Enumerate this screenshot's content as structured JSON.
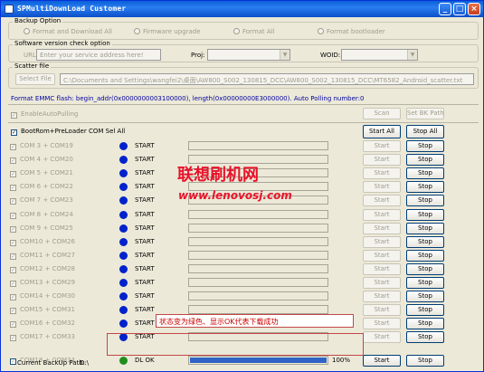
{
  "window": {
    "title": "SPMultiDownLoad Customer",
    "min": "_",
    "max": "□",
    "close": "×"
  },
  "backup_option": {
    "label": "Backup Option",
    "options": [
      "Format and Download All",
      "Firmware upgrade",
      "Format All",
      "Format bootloader"
    ]
  },
  "sw_check": {
    "label": "Software version check option",
    "url_label": "URL:",
    "url_placeholder": "Enter your service address here!",
    "proj_label": "Proj:",
    "woid_label": "WOID:"
  },
  "scatter": {
    "label": "Scatter file",
    "select_button": "Select File",
    "path": "C:\\Documents and Settings\\wangfei2\\桌面\\AW800_S002_130815_DCC\\AW800_S002_130815_DCC\\MT6582_Android_scatter.txt"
  },
  "format_info": "Format EMMC flash:  begin_addr(0x0000000003100000), length(0x00000000E3000000). Auto Polling number:0",
  "auto_polling": {
    "label": "EnableAutoPulling",
    "scan": "Scan",
    "set_bk_path": "Set BK Path"
  },
  "bootrom": {
    "label": "BootRom+PreLoader COM Sel All",
    "start_all": "Start All",
    "stop_all": "Stop All"
  },
  "rows": [
    {
      "name": "COM 3 + COM19",
      "status": "START",
      "start": "Start",
      "stop": "Stop"
    },
    {
      "name": "COM 4 + COM20",
      "status": "START",
      "start": "Start",
      "stop": "Stop"
    },
    {
      "name": "COM 5 + COM21",
      "status": "START",
      "start": "Start",
      "stop": "Stop"
    },
    {
      "name": "COM 6 + COM22",
      "status": "START",
      "start": "Start",
      "stop": "Stop"
    },
    {
      "name": "COM 7 + COM23",
      "status": "START",
      "start": "Start",
      "stop": "Stop"
    },
    {
      "name": "COM 8 + COM24",
      "status": "START",
      "start": "Start",
      "stop": "Stop"
    },
    {
      "name": "COM 9 + COM25",
      "status": "START",
      "start": "Start",
      "stop": "Stop"
    },
    {
      "name": "COM10 + COM26",
      "status": "START",
      "start": "Start",
      "stop": "Stop"
    },
    {
      "name": "COM11 + COM27",
      "status": "START",
      "start": "Start",
      "stop": "Stop"
    },
    {
      "name": "COM12 + COM28",
      "status": "START",
      "start": "Start",
      "stop": "Stop"
    },
    {
      "name": "COM13 + COM29",
      "status": "START",
      "start": "Start",
      "stop": "Stop"
    },
    {
      "name": "COM14 + COM30",
      "status": "START",
      "start": "Start",
      "stop": "Stop"
    },
    {
      "name": "COM15 + COM31",
      "status": "START",
      "start": "Start",
      "stop": "Stop"
    },
    {
      "name": "COM16 + COM32",
      "status": "START",
      "start": "Start",
      "stop": "Stop"
    },
    {
      "name": "COM17 + COM33",
      "status": "START",
      "start": "Start",
      "stop": "Stop"
    },
    {
      "name": "COM18 + COM34",
      "status": "DL OK",
      "start": "Start",
      "stop": "Stop",
      "progress_label": "100%",
      "progress": 1.0
    }
  ],
  "backup_path": {
    "label": "Current BackUp Path:",
    "value": "D:\\"
  },
  "watermark": {
    "title": "联想刷机网",
    "url": "www.lenovosj.com"
  },
  "annotation": "状态变为绿色、显示OK代表下载成功",
  "colors": {
    "dot_blue": "#0022cc",
    "dot_green": "#1e8f1e",
    "progress": "#3163c6",
    "watermark": "#e8132a",
    "title_bar": "#0a5fd9"
  }
}
